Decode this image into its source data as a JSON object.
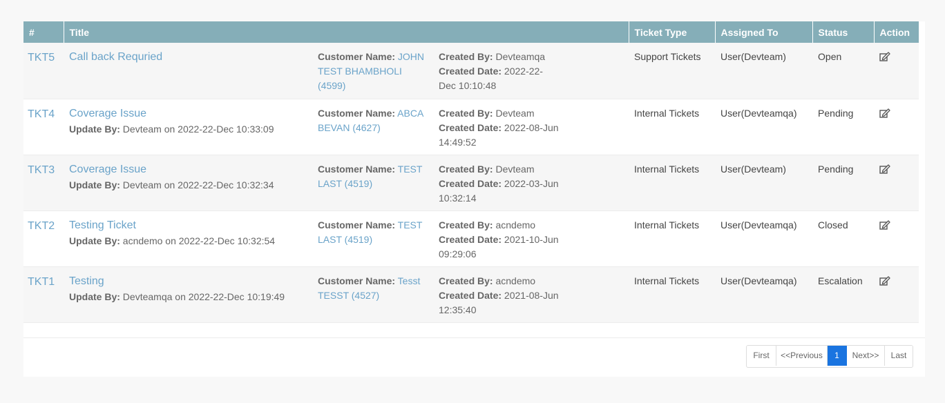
{
  "table": {
    "headers": [
      "#",
      "Title",
      "Ticket Type",
      "Assigned To",
      "Status",
      "Action"
    ],
    "labels": {
      "customer": "Customer Name:",
      "created_by": "Created By:",
      "created_date": "Created Date:",
      "update_by": "Update By:"
    },
    "rows": [
      {
        "id": "TKT5",
        "title": "Call back Requried",
        "update_by": "",
        "update_on": "",
        "customer": "JOHN TEST BHAMBHOLI (4599)",
        "created_by": "Devteamqa",
        "created_date": "2022-22-Dec 10:10:48",
        "type": "Support Tickets",
        "assigned": "User(Devteam)",
        "status": "Open"
      },
      {
        "id": "TKT4",
        "title": "Coverage Issue",
        "update_by": "Devteam",
        "update_on": "on 2022-22-Dec 10:33:09",
        "customer": "ABCA BEVAN (4627)",
        "created_by": "Devteam",
        "created_date": "2022-08-Jun 14:49:52",
        "type": "Internal Tickets",
        "assigned": "User(Devteamqa)",
        "status": "Pending"
      },
      {
        "id": "TKT3",
        "title": "Coverage Issue",
        "update_by": "Devteam",
        "update_on": "on 2022-22-Dec 10:32:34",
        "customer": "TEST LAST (4519)",
        "created_by": "Devteam",
        "created_date": "2022-03-Jun 10:32:14",
        "type": "Internal Tickets",
        "assigned": "User(Devteam)",
        "status": "Pending"
      },
      {
        "id": "TKT2",
        "title": "Testing Ticket",
        "update_by": "acndemo",
        "update_on": "on 2022-22-Dec 10:32:54",
        "customer": "TEST LAST (4519)",
        "created_by": "acndemo",
        "created_date": "2021-10-Jun 09:29:06",
        "type": "Internal Tickets",
        "assigned": "User(Devteamqa)",
        "status": "Closed"
      },
      {
        "id": "TKT1",
        "title": "Testing",
        "update_by": "Devteamqa",
        "update_on": "on 2022-22-Dec 10:19:49",
        "customer": "Tesst TESST (4527)",
        "created_by": "acndemo",
        "created_date": "2021-08-Jun 12:35:40",
        "type": "Internal Tickets",
        "assigned": "User(Devteamqa)",
        "status": "Escalation"
      }
    ]
  },
  "pagination": {
    "first": "First",
    "previous": "<<Previous",
    "current": "1",
    "next": "Next>>",
    "last": "Last"
  },
  "colors": {
    "header_bg": "#85aeb8",
    "link": "#6aa3c9",
    "active_page": "#1a74e0"
  },
  "icons": {
    "action": "edit-icon"
  }
}
